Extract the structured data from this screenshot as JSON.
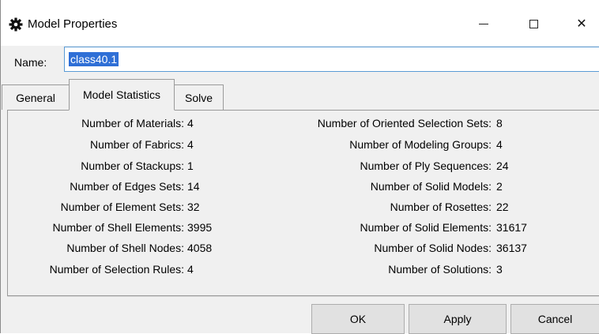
{
  "window": {
    "title": "Model Properties",
    "icon": "gear-icon",
    "minimize_glyph": "minimize-icon",
    "maximize_glyph": "maximize-icon",
    "close_glyph": "✕"
  },
  "name_field": {
    "label": "Name:",
    "value": "class40.1"
  },
  "tabs": [
    {
      "label": "General",
      "selected": false
    },
    {
      "label": "Model Statistics",
      "selected": true
    },
    {
      "label": "Solve",
      "selected": false
    }
  ],
  "stats_left": [
    {
      "label": "Number of Materials:",
      "value": "4"
    },
    {
      "label": "Number of Fabrics:",
      "value": "4"
    },
    {
      "label": "Number of Stackups:",
      "value": "1"
    },
    {
      "label": "Number of Edges Sets:",
      "value": "14"
    },
    {
      "label": "Number of Element Sets:",
      "value": "32"
    },
    {
      "label": "Number of Shell Elements:",
      "value": "3995"
    },
    {
      "label": "Number of Shell Nodes:",
      "value": "4058"
    },
    {
      "label": "Number of Selection Rules:",
      "value": "4"
    }
  ],
  "stats_right": [
    {
      "label": "Number of Oriented Selection Sets:",
      "value": "8"
    },
    {
      "label": "Number of Modeling Groups:",
      "value": "4"
    },
    {
      "label": "Number of Ply Sequences:",
      "value": "24"
    },
    {
      "label": "Number of Solid Models:",
      "value": "2"
    },
    {
      "label": "Number of Rosettes:",
      "value": "22"
    },
    {
      "label": "Number of Solid Elements:",
      "value": "31617"
    },
    {
      "label": "Number of Solid Nodes:",
      "value": "36137"
    },
    {
      "label": "Number of Solutions:",
      "value": "3"
    }
  ],
  "buttons": {
    "ok": "OK",
    "apply": "Apply",
    "cancel": "Cancel"
  }
}
